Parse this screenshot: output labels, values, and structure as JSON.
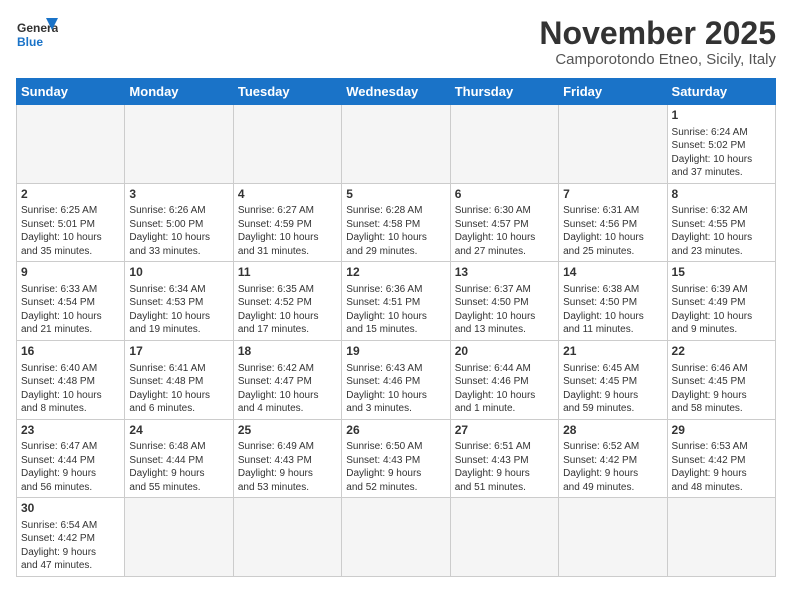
{
  "logo": {
    "general": "General",
    "blue": "Blue"
  },
  "title": "November 2025",
  "subtitle": "Camporotondo Etneo, Sicily, Italy",
  "weekdays": [
    "Sunday",
    "Monday",
    "Tuesday",
    "Wednesday",
    "Thursday",
    "Friday",
    "Saturday"
  ],
  "weeks": [
    [
      {
        "day": "",
        "info": "",
        "empty": true
      },
      {
        "day": "",
        "info": "",
        "empty": true
      },
      {
        "day": "",
        "info": "",
        "empty": true
      },
      {
        "day": "",
        "info": "",
        "empty": true
      },
      {
        "day": "",
        "info": "",
        "empty": true
      },
      {
        "day": "",
        "info": "",
        "empty": true
      },
      {
        "day": "1",
        "info": "Sunrise: 6:24 AM\nSunset: 5:02 PM\nDaylight: 10 hours\nand 37 minutes.",
        "empty": false
      }
    ],
    [
      {
        "day": "2",
        "info": "Sunrise: 6:25 AM\nSunset: 5:01 PM\nDaylight: 10 hours\nand 35 minutes.",
        "empty": false
      },
      {
        "day": "3",
        "info": "Sunrise: 6:26 AM\nSunset: 5:00 PM\nDaylight: 10 hours\nand 33 minutes.",
        "empty": false
      },
      {
        "day": "4",
        "info": "Sunrise: 6:27 AM\nSunset: 4:59 PM\nDaylight: 10 hours\nand 31 minutes.",
        "empty": false
      },
      {
        "day": "5",
        "info": "Sunrise: 6:28 AM\nSunset: 4:58 PM\nDaylight: 10 hours\nand 29 minutes.",
        "empty": false
      },
      {
        "day": "6",
        "info": "Sunrise: 6:30 AM\nSunset: 4:57 PM\nDaylight: 10 hours\nand 27 minutes.",
        "empty": false
      },
      {
        "day": "7",
        "info": "Sunrise: 6:31 AM\nSunset: 4:56 PM\nDaylight: 10 hours\nand 25 minutes.",
        "empty": false
      },
      {
        "day": "8",
        "info": "Sunrise: 6:32 AM\nSunset: 4:55 PM\nDaylight: 10 hours\nand 23 minutes.",
        "empty": false
      }
    ],
    [
      {
        "day": "9",
        "info": "Sunrise: 6:33 AM\nSunset: 4:54 PM\nDaylight: 10 hours\nand 21 minutes.",
        "empty": false
      },
      {
        "day": "10",
        "info": "Sunrise: 6:34 AM\nSunset: 4:53 PM\nDaylight: 10 hours\nand 19 minutes.",
        "empty": false
      },
      {
        "day": "11",
        "info": "Sunrise: 6:35 AM\nSunset: 4:52 PM\nDaylight: 10 hours\nand 17 minutes.",
        "empty": false
      },
      {
        "day": "12",
        "info": "Sunrise: 6:36 AM\nSunset: 4:51 PM\nDaylight: 10 hours\nand 15 minutes.",
        "empty": false
      },
      {
        "day": "13",
        "info": "Sunrise: 6:37 AM\nSunset: 4:50 PM\nDaylight: 10 hours\nand 13 minutes.",
        "empty": false
      },
      {
        "day": "14",
        "info": "Sunrise: 6:38 AM\nSunset: 4:50 PM\nDaylight: 10 hours\nand 11 minutes.",
        "empty": false
      },
      {
        "day": "15",
        "info": "Sunrise: 6:39 AM\nSunset: 4:49 PM\nDaylight: 10 hours\nand 9 minutes.",
        "empty": false
      }
    ],
    [
      {
        "day": "16",
        "info": "Sunrise: 6:40 AM\nSunset: 4:48 PM\nDaylight: 10 hours\nand 8 minutes.",
        "empty": false
      },
      {
        "day": "17",
        "info": "Sunrise: 6:41 AM\nSunset: 4:48 PM\nDaylight: 10 hours\nand 6 minutes.",
        "empty": false
      },
      {
        "day": "18",
        "info": "Sunrise: 6:42 AM\nSunset: 4:47 PM\nDaylight: 10 hours\nand 4 minutes.",
        "empty": false
      },
      {
        "day": "19",
        "info": "Sunrise: 6:43 AM\nSunset: 4:46 PM\nDaylight: 10 hours\nand 3 minutes.",
        "empty": false
      },
      {
        "day": "20",
        "info": "Sunrise: 6:44 AM\nSunset: 4:46 PM\nDaylight: 10 hours\nand 1 minute.",
        "empty": false
      },
      {
        "day": "21",
        "info": "Sunrise: 6:45 AM\nSunset: 4:45 PM\nDaylight: 9 hours\nand 59 minutes.",
        "empty": false
      },
      {
        "day": "22",
        "info": "Sunrise: 6:46 AM\nSunset: 4:45 PM\nDaylight: 9 hours\nand 58 minutes.",
        "empty": false
      }
    ],
    [
      {
        "day": "23",
        "info": "Sunrise: 6:47 AM\nSunset: 4:44 PM\nDaylight: 9 hours\nand 56 minutes.",
        "empty": false
      },
      {
        "day": "24",
        "info": "Sunrise: 6:48 AM\nSunset: 4:44 PM\nDaylight: 9 hours\nand 55 minutes.",
        "empty": false
      },
      {
        "day": "25",
        "info": "Sunrise: 6:49 AM\nSunset: 4:43 PM\nDaylight: 9 hours\nand 53 minutes.",
        "empty": false
      },
      {
        "day": "26",
        "info": "Sunrise: 6:50 AM\nSunset: 4:43 PM\nDaylight: 9 hours\nand 52 minutes.",
        "empty": false
      },
      {
        "day": "27",
        "info": "Sunrise: 6:51 AM\nSunset: 4:43 PM\nDaylight: 9 hours\nand 51 minutes.",
        "empty": false
      },
      {
        "day": "28",
        "info": "Sunrise: 6:52 AM\nSunset: 4:42 PM\nDaylight: 9 hours\nand 49 minutes.",
        "empty": false
      },
      {
        "day": "29",
        "info": "Sunrise: 6:53 AM\nSunset: 4:42 PM\nDaylight: 9 hours\nand 48 minutes.",
        "empty": false
      }
    ],
    [
      {
        "day": "30",
        "info": "Sunrise: 6:54 AM\nSunset: 4:42 PM\nDaylight: 9 hours\nand 47 minutes.",
        "empty": false
      },
      {
        "day": "",
        "info": "",
        "empty": true
      },
      {
        "day": "",
        "info": "",
        "empty": true
      },
      {
        "day": "",
        "info": "",
        "empty": true
      },
      {
        "day": "",
        "info": "",
        "empty": true
      },
      {
        "day": "",
        "info": "",
        "empty": true
      },
      {
        "day": "",
        "info": "",
        "empty": true
      }
    ]
  ]
}
